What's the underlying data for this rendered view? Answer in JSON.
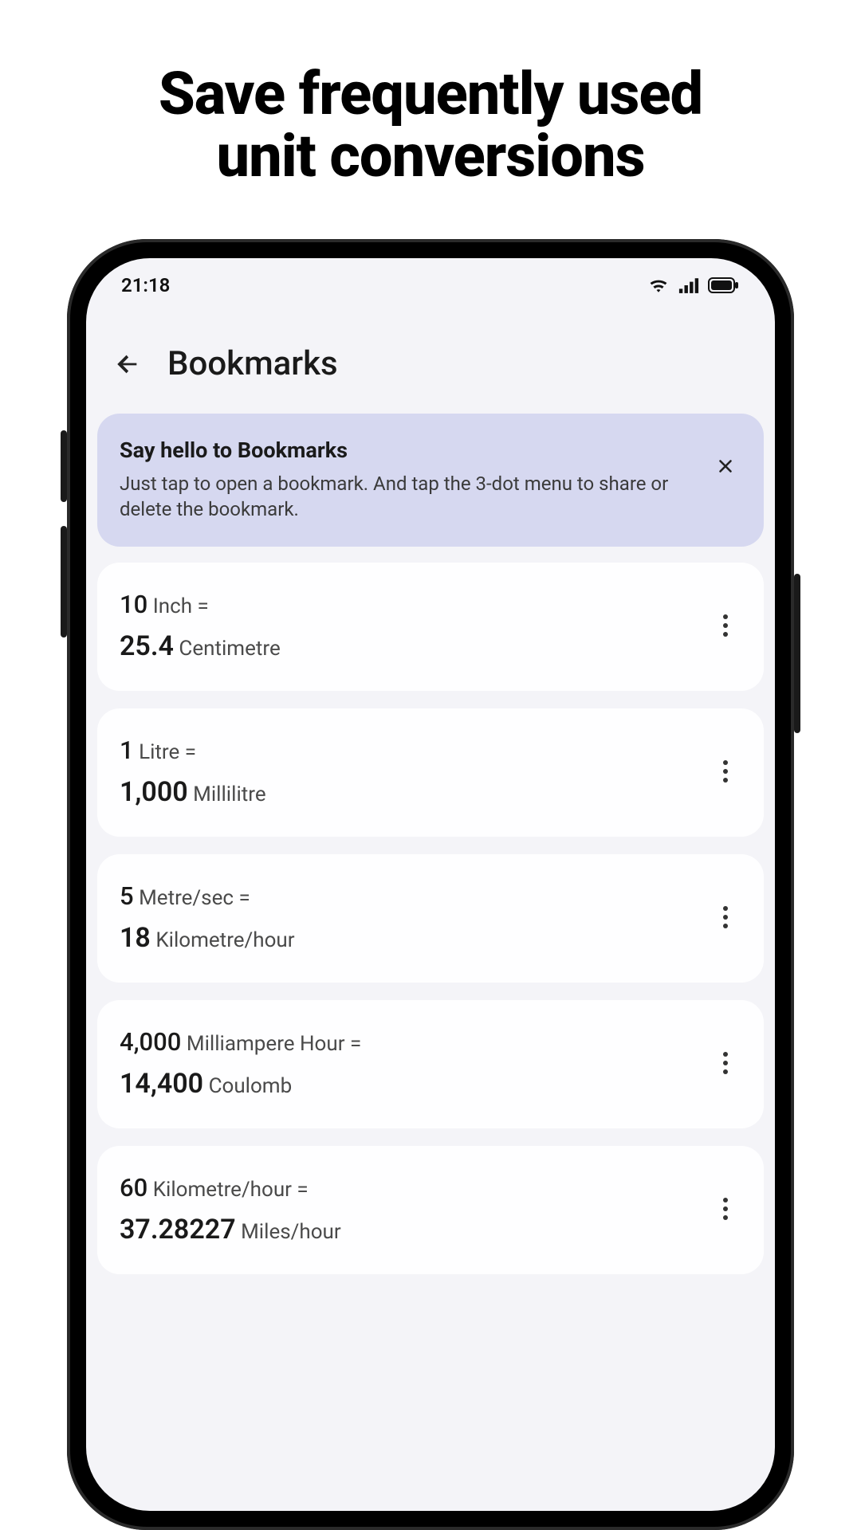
{
  "hero": {
    "line1": "Save frequently used",
    "line2": "unit conversions"
  },
  "status": {
    "time": "21:18"
  },
  "appbar": {
    "title": "Bookmarks"
  },
  "banner": {
    "title": "Say hello to Bookmarks",
    "body": "Just tap to open a bookmark. And tap the 3-dot menu to share or delete the bookmark."
  },
  "equals": "=",
  "items": [
    {
      "from_val": "10",
      "from_unit": "Inch",
      "to_val": "25.4",
      "to_unit": "Centimetre"
    },
    {
      "from_val": "1",
      "from_unit": "Litre",
      "to_val": "1,000",
      "to_unit": "Millilitre"
    },
    {
      "from_val": "5",
      "from_unit": "Metre/sec",
      "to_val": "18",
      "to_unit": "Kilometre/hour"
    },
    {
      "from_val": "4,000",
      "from_unit": "Milliampere Hour",
      "to_val": "14,400",
      "to_unit": "Coulomb"
    },
    {
      "from_val": "60",
      "from_unit": "Kilometre/hour",
      "to_val": "37.28227",
      "to_unit": "Miles/hour"
    }
  ]
}
